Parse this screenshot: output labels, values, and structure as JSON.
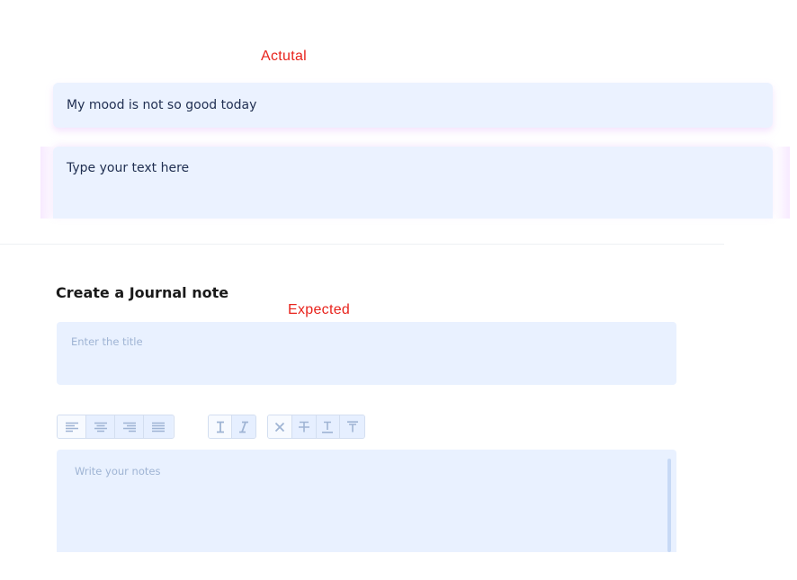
{
  "annotations": {
    "actual_label": "Actutal",
    "expected_label": "Expected"
  },
  "actual": {
    "title_value": "My mood is not so good today",
    "notes_placeholder": "Type your text here"
  },
  "expected": {
    "page_title": "Create a Journal note",
    "title_placeholder": "Enter the title",
    "notes_placeholder": "Write your notes",
    "toolbar": {
      "alignment": [
        "align-left-icon",
        "align-center-icon",
        "align-right-icon",
        "align-justify-icon"
      ],
      "style": [
        "text-cursor-icon",
        "italic-icon"
      ],
      "format": [
        "clear-format-icon",
        "strikethrough-icon",
        "underline-icon",
        "overline-icon"
      ]
    }
  },
  "colors": {
    "annotation": "#e8231c",
    "field_background": "#e9f1ff",
    "placeholder": "#9fb4d4",
    "icon": "#9fb4d4"
  }
}
